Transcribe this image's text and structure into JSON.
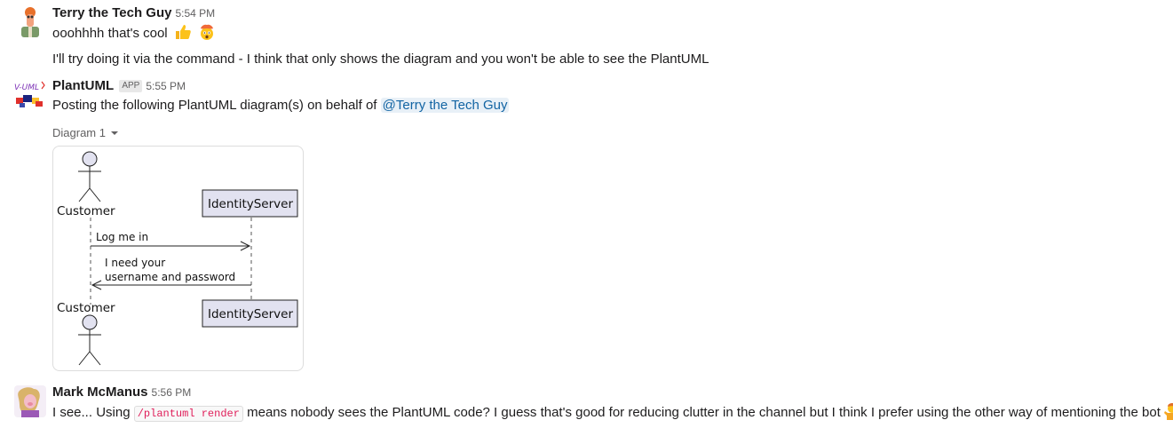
{
  "messages": {
    "terry": {
      "name": "Terry the Tech Guy",
      "time": "5:54 PM",
      "line1": "ooohhhh that's cool",
      "line1_emojis": [
        "thumbs-up-icon",
        "exploding-head-icon"
      ],
      "line2": "I'll try doing it via the command - I think that only shows the diagram and you won't be able to see the PlantUML"
    },
    "plantuml": {
      "name": "PlantUML",
      "badge": "APP",
      "time": "5:55 PM",
      "avatar_text": "V-UML",
      "text_before": "Posting the following PlantUML diagram(s) on behalf of ",
      "mention": "@Terry the Tech Guy",
      "diagram_label": "Diagram 1",
      "diagram": {
        "participants": [
          "Customer",
          "IdentityServer"
        ],
        "arrow1": "Log me in",
        "arrow2_line1": "I need your",
        "arrow2_line2": "username and password"
      }
    },
    "mark": {
      "name": "Mark McManus",
      "time": "5:56 PM",
      "text_before": "I see... Using ",
      "code": "/plantuml render",
      "text_after": " means nobody sees the PlantUML code? I guess that's good for reducing clutter in the channel but I think I prefer using the other way of mentioning the bot",
      "end_emoji": "person-shrugging-icon"
    }
  },
  "colors": {
    "mention": "#1264a3",
    "participant_fill": "#e2e2f0",
    "code_text": "#e01e5a"
  }
}
